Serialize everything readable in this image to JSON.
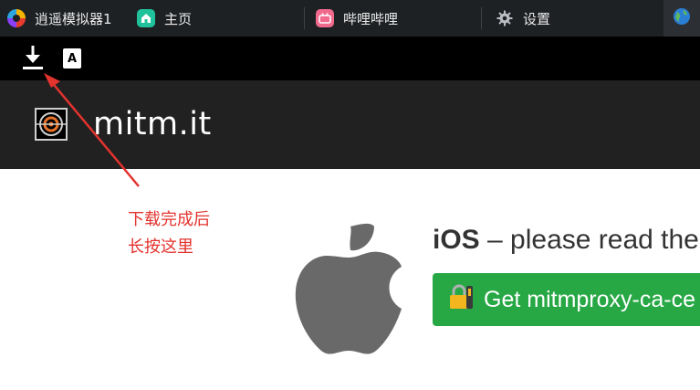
{
  "tabs": [
    {
      "label": "逍遥模拟器1",
      "icon": "xiaoyao-app-icon"
    },
    {
      "label": "主页",
      "icon": "home-icon"
    },
    {
      "label": "哔哩哔哩",
      "icon": "bilibili-icon"
    },
    {
      "label": "设置",
      "icon": "gear-icon"
    }
  ],
  "browser_tab_icon": "globe-icon",
  "toolbar": {
    "download_icon": "download-icon",
    "font_icon": "font-icon",
    "font_label": "A"
  },
  "header": {
    "title": "mitm.it",
    "logo_icon": "mitmproxy-logo-icon"
  },
  "annotation": {
    "line1": "下载完成后",
    "line2": "长按这里",
    "color": "#e3332e"
  },
  "ios": {
    "heading_bold": "iOS",
    "heading_rest": " – please read the",
    "button_label": "Get mitmproxy-ca-ce",
    "button_color": "#27a845",
    "apple_icon": "apple-logo-icon",
    "lock_icon": "lock-icon"
  }
}
